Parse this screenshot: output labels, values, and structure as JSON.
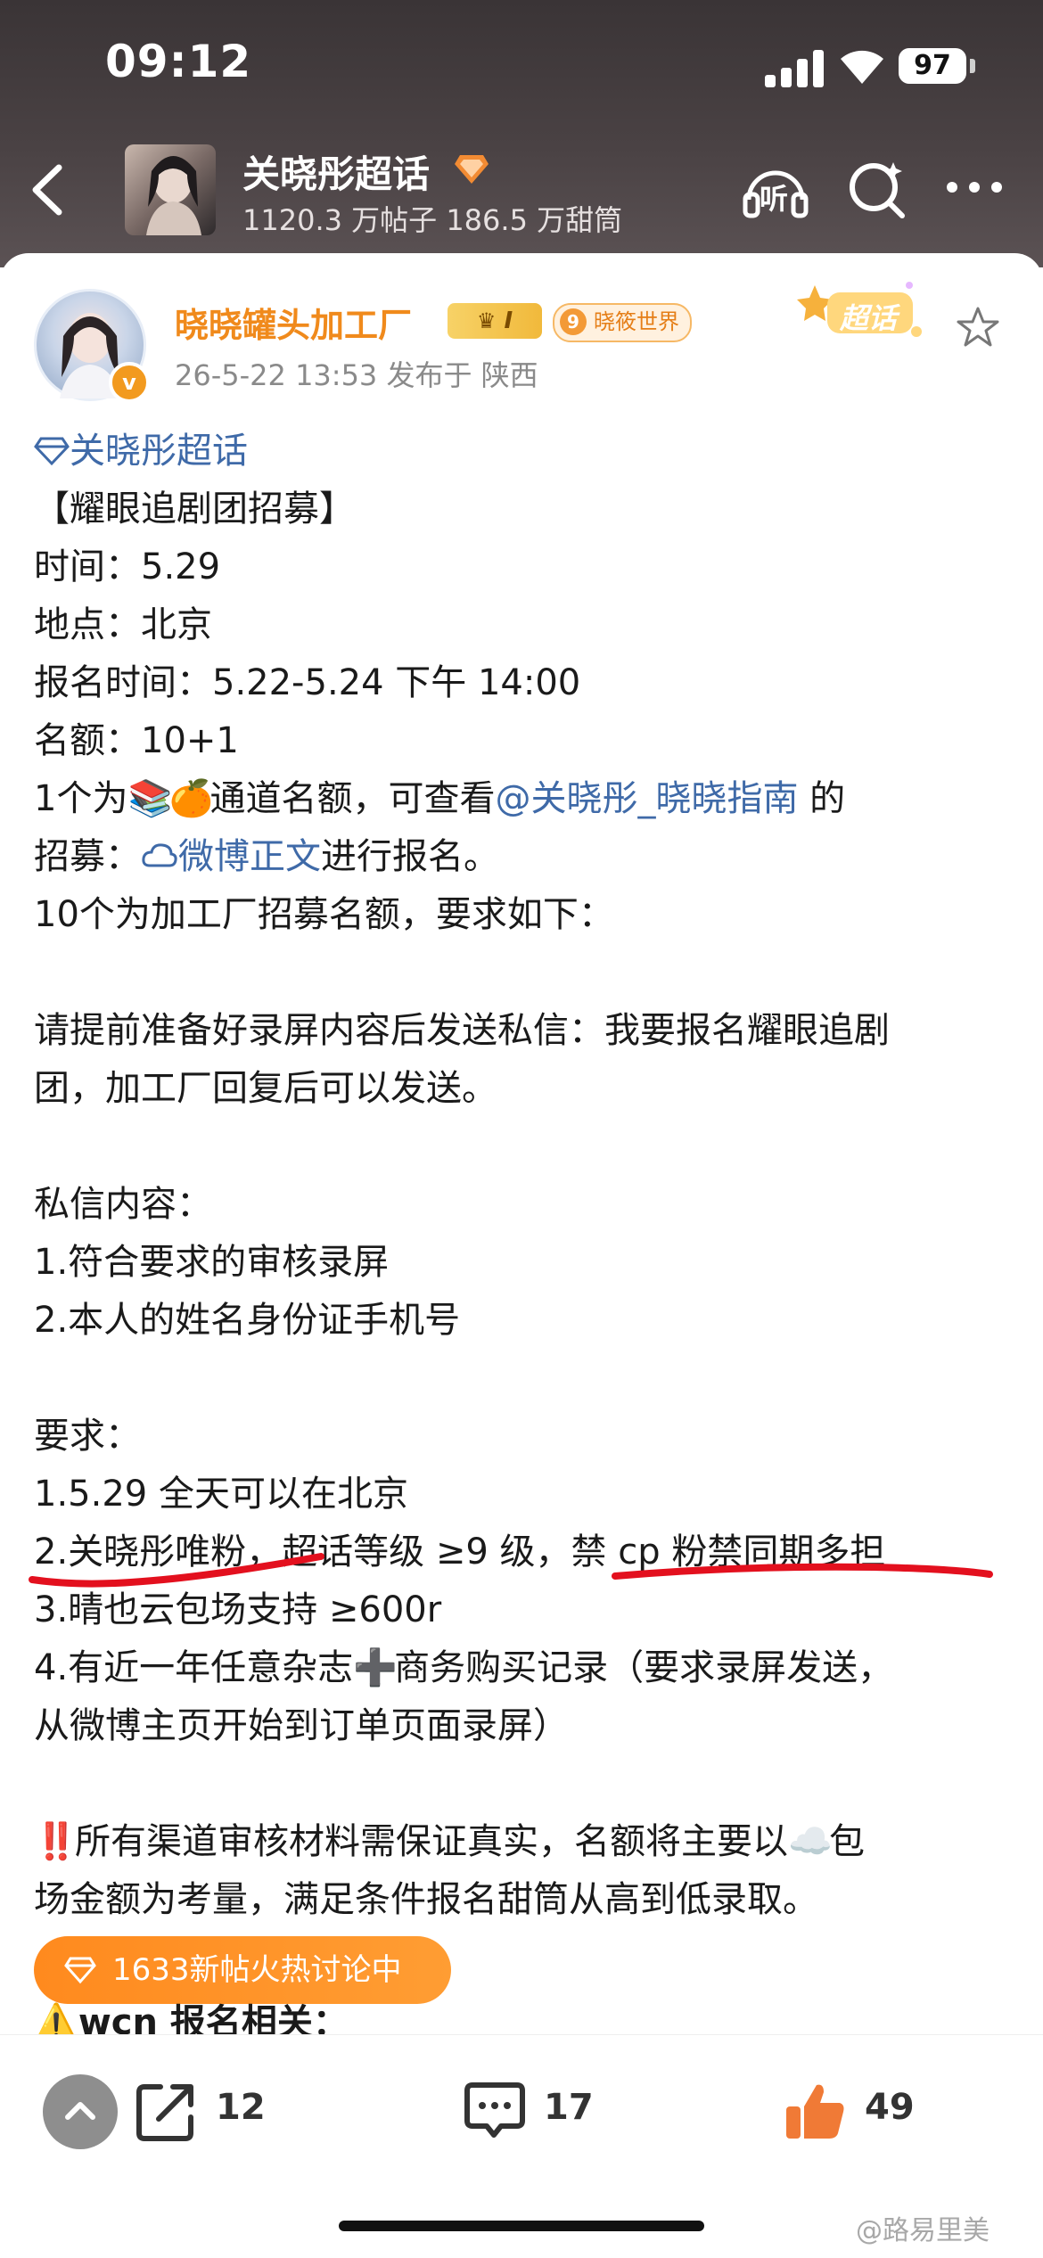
{
  "status_bar": {
    "time": "09:12",
    "battery": "97"
  },
  "header": {
    "topic_title": "关晓彤超话",
    "topic_stats": "1120.3 万帖子 186.5 万甜筒",
    "listen_label": "听"
  },
  "post": {
    "author_name": "晓晓罐头加工厂",
    "level_badge": "I",
    "fan_badge": {
      "level": "9",
      "label": "晓筱世界"
    },
    "meta": "26-5-22 13:53  发布于 陕西",
    "chaohua_tag": "超话",
    "lines": {
      "l1_topic": "关晓彤超话",
      "l2": "【耀眼追剧团招募】",
      "l3": "时间：5.29",
      "l4": "地点：北京",
      "l5": "报名时间：5.22-5.24 下午 14:00",
      "l6": "名额：10+1",
      "l7_a": "1个为",
      "l7_b": "通道名额，可查看",
      "l7_mention": "@关晓彤_晓晓指南",
      "l7_c": " 的",
      "l8_a": "招募：",
      "l8_link": "微博正文",
      "l8_b": "进行报名。",
      "l9": "10个为加工厂招募名额，要求如下：",
      "l11": "请提前准备好录屏内容后发送私信：我要报名耀眼追剧",
      "l12": "团，加工厂回复后可以发送。",
      "l14": "私信内容：",
      "l15": "1.符合要求的审核录屏",
      "l16": "2.本人的姓名身份证手机号",
      "l18": "要求：",
      "l19": "1.5.29 全天可以在北京",
      "l20": "2.关晓彤唯粉，超话等级 ≥9 级，禁 cp 粉禁同期多担",
      "l21": "3.晴也云包场支持 ≥600r",
      "l22_a": "4.有近一年任意杂志",
      "l22_b": "商务购买记录（要求录屏发送，",
      "l23": "从微博主页开始到订单页面录屏）",
      "l25_a": "所有渠道审核材料需保证真实，名额将主要以",
      "l25_b": "包",
      "l26": "场金额为考量，满足条件报名甜筒从高到低录取。",
      "l27_partial": "wcn 报名相关："
    },
    "emoji": {
      "books": "📚",
      "orange": "🍊",
      "plus": "➕",
      "double_exclamation": "‼️",
      "cloud": "☁️",
      "warning": "⚠️"
    }
  },
  "hot_pill": {
    "label": "1633新帖火热讨论中"
  },
  "actions": {
    "share_count": "12",
    "comment_count": "17",
    "like_count": "49"
  },
  "watermark": "@路易里美"
}
